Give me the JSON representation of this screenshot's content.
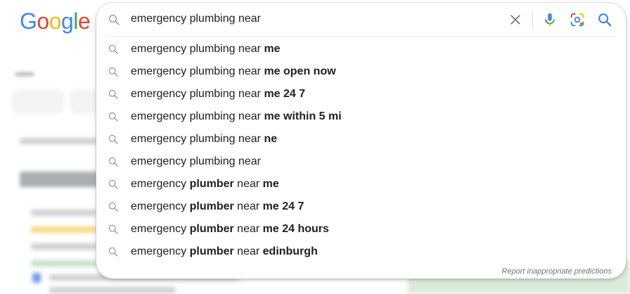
{
  "logo": {
    "letters": [
      "G",
      "o",
      "o",
      "g",
      "l",
      "e"
    ]
  },
  "search": {
    "query": "emergency plumbing near"
  },
  "suggestions": [
    [
      {
        "t": "emergency plumbing near ",
        "b": false
      },
      {
        "t": "me",
        "b": true
      }
    ],
    [
      {
        "t": "emergency plumbing near ",
        "b": false
      },
      {
        "t": "me open now",
        "b": true
      }
    ],
    [
      {
        "t": "emergency plumbing near ",
        "b": false
      },
      {
        "t": "me 24 7",
        "b": true
      }
    ],
    [
      {
        "t": "emergency plumbing near ",
        "b": false
      },
      {
        "t": "me within 5 mi",
        "b": true
      }
    ],
    [
      {
        "t": "emergency plumbing near ",
        "b": false
      },
      {
        "t": "ne",
        "b": true
      }
    ],
    [
      {
        "t": "emergency plumbing near",
        "b": false
      }
    ],
    [
      {
        "t": "emergency ",
        "b": false
      },
      {
        "t": "plumber",
        "b": true
      },
      {
        "t": " near ",
        "b": false
      },
      {
        "t": "me",
        "b": true
      }
    ],
    [
      {
        "t": "emergency ",
        "b": false
      },
      {
        "t": "plumber",
        "b": true
      },
      {
        "t": " near ",
        "b": false
      },
      {
        "t": "me 24 7",
        "b": true
      }
    ],
    [
      {
        "t": "emergency ",
        "b": false
      },
      {
        "t": "plumber",
        "b": true
      },
      {
        "t": " near ",
        "b": false
      },
      {
        "t": "me 24 hours",
        "b": true
      }
    ],
    [
      {
        "t": "emergency ",
        "b": false
      },
      {
        "t": "plumber",
        "b": true
      },
      {
        "t": " near ",
        "b": false
      },
      {
        "t": "edinburgh",
        "b": true
      }
    ]
  ],
  "report_link": "Report inappropriate predictions",
  "colors": {
    "blue": "#4285f4",
    "red": "#ea4335",
    "yellow": "#fbbc05",
    "green": "#34a853",
    "text": "#202124",
    "icon": "#9aa0a6"
  }
}
